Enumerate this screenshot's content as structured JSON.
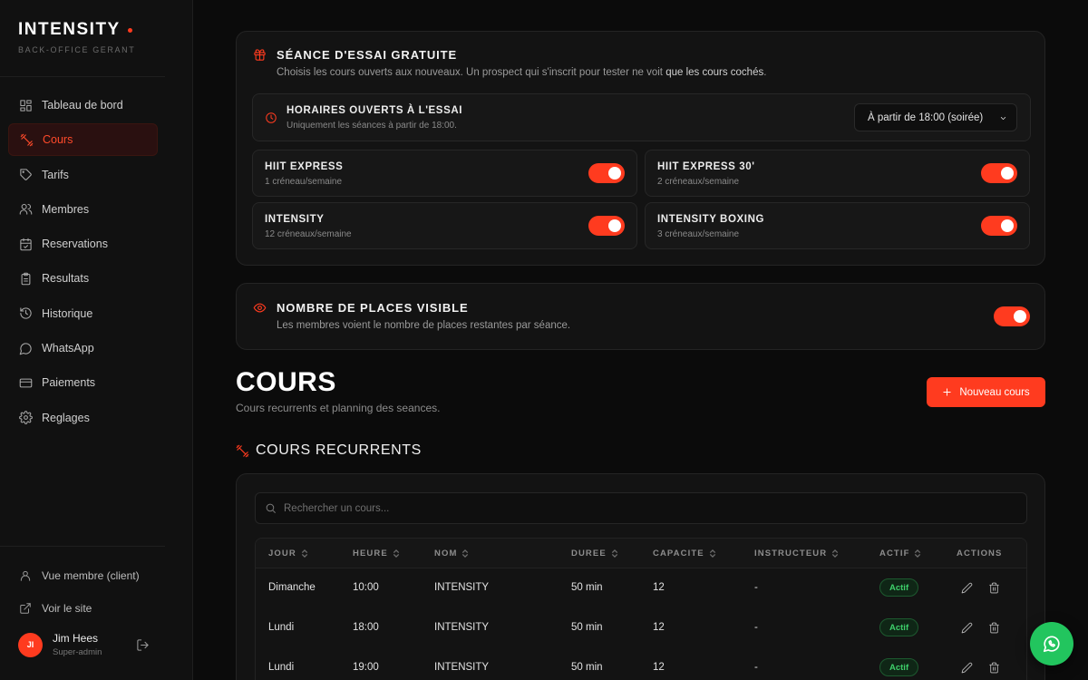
{
  "brand": {
    "name": "INTENSITY",
    "subtitle": "BACK-OFFICE GERANT",
    "accent": "#ff3b1f"
  },
  "sidebar": {
    "items": [
      {
        "label": "Tableau de bord",
        "icon": "dashboard-icon",
        "active": false
      },
      {
        "label": "Cours",
        "icon": "dumbbell-icon",
        "active": true
      },
      {
        "label": "Tarifs",
        "icon": "tag-icon",
        "active": false
      },
      {
        "label": "Membres",
        "icon": "users-icon",
        "active": false
      },
      {
        "label": "Reservations",
        "icon": "calendar-icon",
        "active": false
      },
      {
        "label": "Resultats",
        "icon": "clipboard-icon",
        "active": false
      },
      {
        "label": "Historique",
        "icon": "history-icon",
        "active": false
      },
      {
        "label": "WhatsApp",
        "icon": "chat-icon",
        "active": false
      },
      {
        "label": "Paiements",
        "icon": "credit-card-icon",
        "active": false
      },
      {
        "label": "Reglages",
        "icon": "gear-icon",
        "active": false
      }
    ],
    "bottom_links": [
      {
        "label": "Vue membre (client)",
        "icon": "user-icon"
      },
      {
        "label": "Voir le site",
        "icon": "external-link-icon"
      }
    ],
    "user": {
      "initials": "JI",
      "name": "Jim Hees",
      "role": "Super-admin"
    }
  },
  "trial": {
    "title": "SÉANCE D'ESSAI GRATUITE",
    "desc_prefix": "Choisis les cours ouverts aux nouveaux. Un prospect qui s'inscrit pour tester ne voit ",
    "desc_emph": "que les cours cochés",
    "desc_suffix": ".",
    "schedule": {
      "title": "HORAIRES OUVERTS À L'ESSAI",
      "desc": "Uniquement les séances à partir de 18:00.",
      "selected": "À partir de 18:00 (soirée)"
    },
    "courses": [
      {
        "name": "HIIT EXPRESS",
        "slots": "1 créneau/semaine",
        "enabled": true
      },
      {
        "name": "HIIT EXPRESS 30'",
        "slots": "2 créneaux/semaine",
        "enabled": true
      },
      {
        "name": "INTENSITY",
        "slots": "12 créneaux/semaine",
        "enabled": true
      },
      {
        "name": "INTENSITY BOXING",
        "slots": "3 créneaux/semaine",
        "enabled": true
      }
    ]
  },
  "places": {
    "title": "NOMBRE DE PLACES VISIBLE",
    "desc": "Les membres voient le nombre de places restantes par séance.",
    "enabled": true
  },
  "cours": {
    "title": "COURS",
    "subtitle": "Cours recurrents et planning des seances.",
    "new_button": "Nouveau cours",
    "section_title": "COURS RECURRENTS",
    "search_placeholder": "Rechercher un cours...",
    "columns": [
      "JOUR",
      "HEURE",
      "NOM",
      "DUREE",
      "CAPACITE",
      "INSTRUCTEUR",
      "ACTIF",
      "ACTIONS"
    ],
    "rows": [
      {
        "jour": "Dimanche",
        "heure": "10:00",
        "nom": "INTENSITY",
        "duree": "50 min",
        "capacite": "12",
        "instructeur": "-",
        "actif": "Actif"
      },
      {
        "jour": "Lundi",
        "heure": "18:00",
        "nom": "INTENSITY",
        "duree": "50 min",
        "capacite": "12",
        "instructeur": "-",
        "actif": "Actif"
      },
      {
        "jour": "Lundi",
        "heure": "19:00",
        "nom": "INTENSITY",
        "duree": "50 min",
        "capacite": "12",
        "instructeur": "-",
        "actif": "Actif"
      }
    ]
  },
  "fab": {
    "icon": "whatsapp-icon",
    "color": "#22c55e"
  }
}
